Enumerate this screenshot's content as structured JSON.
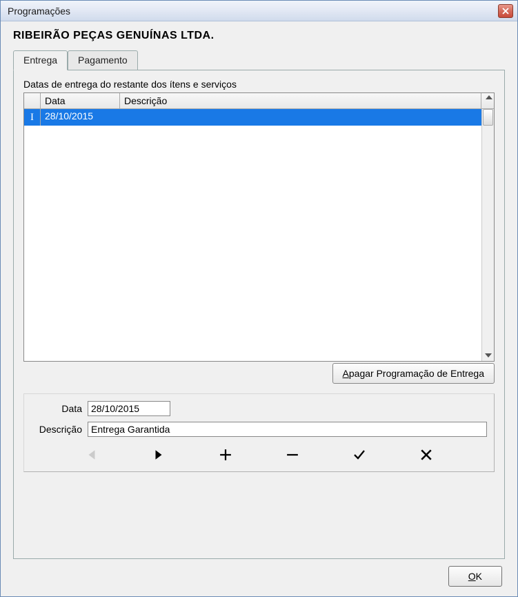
{
  "window": {
    "title": "Programações"
  },
  "company": "RIBEIRÃO PEÇAS GENUÍNAS LTDA.",
  "tabs": [
    {
      "label": "Entrega",
      "active": true
    },
    {
      "label": "Pagamento",
      "active": false
    }
  ],
  "grid": {
    "caption": "Datas de entrega do restante dos ítens e serviços",
    "headers": {
      "data": "Data",
      "descricao": "Descrição"
    },
    "rows": [
      {
        "data": "28/10/2015",
        "descricao": "",
        "selected": true,
        "editing": true
      }
    ]
  },
  "buttons": {
    "clear": "Apagar Programação de Entrega",
    "clear_mnemonic": "A",
    "ok": "OK",
    "ok_mnemonic": "O"
  },
  "form": {
    "data_label": "Data",
    "data_value": "28/10/2015",
    "descricao_label": "Descrição",
    "descricao_value": "Entrega Garantida"
  },
  "nav": {
    "first": "first",
    "next": "next",
    "add": "add",
    "remove": "remove",
    "confirm": "confirm",
    "cancel": "cancel"
  }
}
